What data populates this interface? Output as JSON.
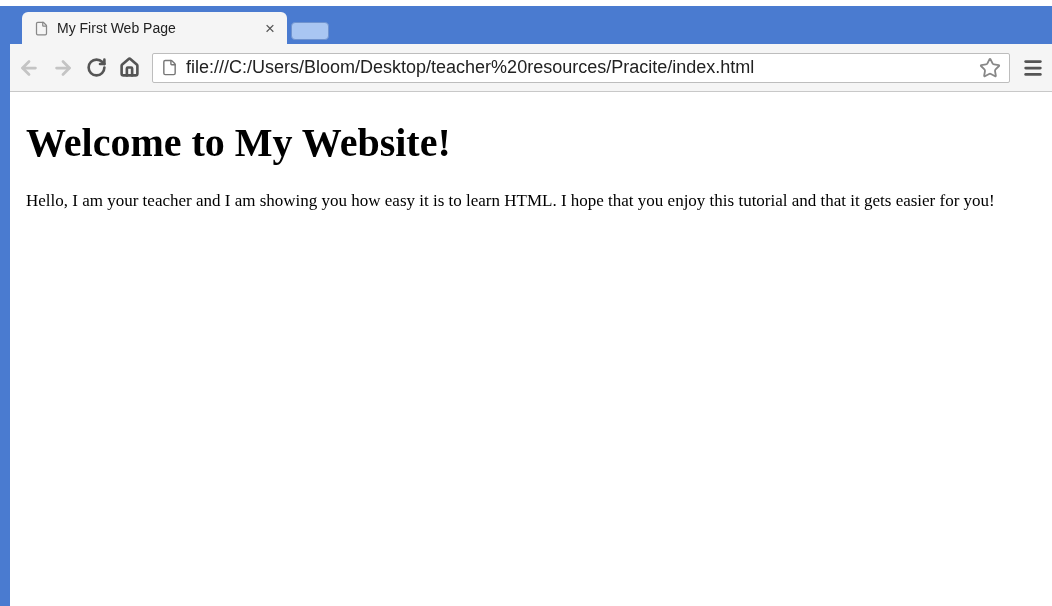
{
  "tabs": [
    {
      "title": "My First Web Page",
      "close": "×",
      "selected": true
    }
  ],
  "toolbar": {
    "back": {
      "disabled": true
    },
    "forward": {
      "disabled": true
    },
    "address": "file:///C:/Users/Bloom/Desktop/teacher%20resources/Pracite/index.html"
  },
  "page": {
    "heading": "Welcome to My Website!",
    "paragraph": "Hello, I am your teacher and I am showing you how easy it is to learn HTML. I hope that you enjoy this tutorial and that it gets easier for you!"
  }
}
